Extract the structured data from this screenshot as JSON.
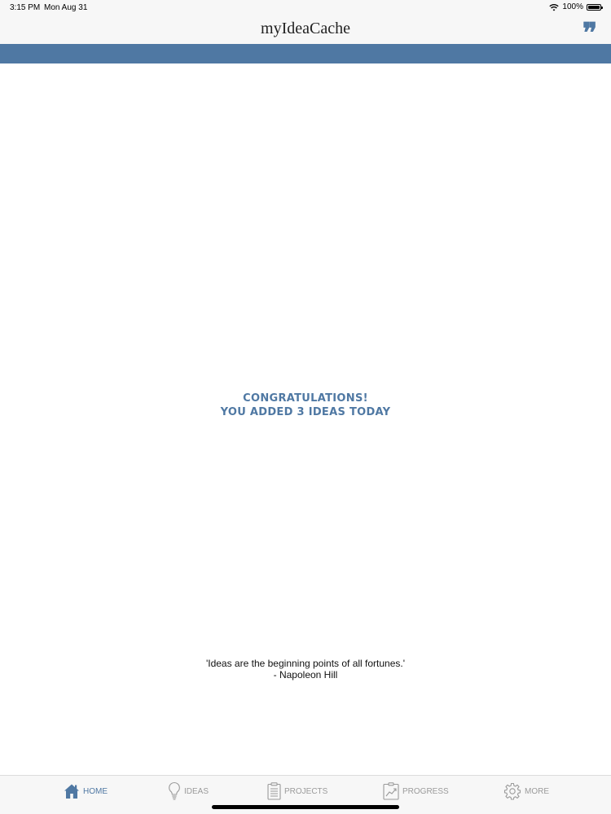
{
  "status_bar": {
    "time": "3:15 PM",
    "date": "Mon Aug 31",
    "battery": "100%",
    "battery_level": 1.0
  },
  "nav": {
    "title": "myIdeaCache",
    "quote_glyph": "❞"
  },
  "main": {
    "congrats_line1": "CONGRATULATIONS!",
    "congrats_line2": "YOU ADDED 3 IDEAS TODAY",
    "quote_text": "'Ideas are the beginning points of all fortunes.'",
    "quote_author": "- Napoleon Hill"
  },
  "tabs": [
    {
      "label": "HOME",
      "icon": "home-icon",
      "active": true
    },
    {
      "label": "IDEAS",
      "icon": "lightbulb-icon",
      "active": false
    },
    {
      "label": "PROJECTS",
      "icon": "clipboard-icon",
      "active": false
    },
    {
      "label": "PROGRESS",
      "icon": "chart-icon",
      "active": false
    },
    {
      "label": "MORE",
      "icon": "gear-icon",
      "active": false
    }
  ],
  "colors": {
    "accent": "#4f78a3",
    "inactive": "#9a9a9a",
    "bar_background": "#f7f7f7"
  }
}
